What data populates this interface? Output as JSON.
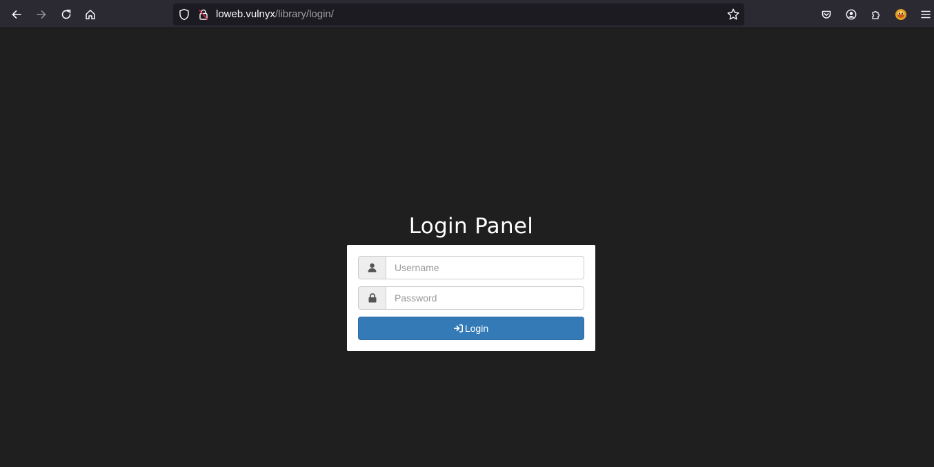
{
  "browser": {
    "url_host": "loweb.vulnyx",
    "url_path": "/library/login/",
    "icons": [
      "back-icon",
      "forward-icon",
      "reload-icon",
      "home-icon",
      "shield-icon",
      "lock-icon",
      "bookmark-star-icon",
      "pocket-icon",
      "account-icon",
      "extensions-icon",
      "profile-avatar-icon",
      "menu-icon"
    ]
  },
  "page": {
    "title": "Login Panel"
  },
  "login_form": {
    "username_placeholder": "Username",
    "username_value": "",
    "password_placeholder": "Password",
    "password_value": "",
    "submit_label": "Login",
    "user_icon": "user-icon",
    "password_icon": "lock-icon",
    "submit_icon": "sign-in-icon"
  },
  "colors": {
    "page_background": "#1f1f1f",
    "toolbar_background": "#2b2a33",
    "urlbar_background": "#1c1b22",
    "button_primary": "#337ab7"
  }
}
